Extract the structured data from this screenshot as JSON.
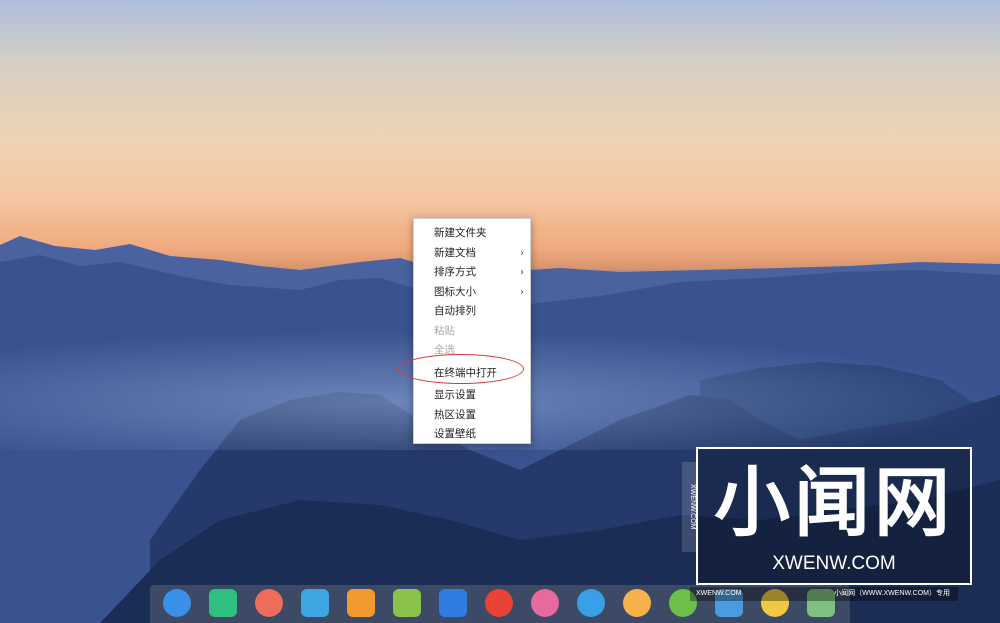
{
  "context_menu": {
    "items": [
      {
        "label": "新建文件夹",
        "submenu": false,
        "disabled": false
      },
      {
        "label": "新建文档",
        "submenu": true,
        "disabled": false
      },
      {
        "label": "排序方式",
        "submenu": true,
        "disabled": false
      },
      {
        "label": "图标大小",
        "submenu": true,
        "disabled": false
      },
      {
        "label": "自动排列",
        "submenu": false,
        "disabled": false
      },
      {
        "label": "粘贴",
        "submenu": false,
        "disabled": true
      },
      {
        "label": "全选",
        "submenu": false,
        "disabled": true
      },
      {
        "label": "在终端中打开",
        "submenu": false,
        "disabled": false,
        "highlighted": true
      },
      {
        "label": "显示设置",
        "submenu": false,
        "disabled": false
      },
      {
        "label": "热区设置",
        "submenu": false,
        "disabled": false
      },
      {
        "label": "设置壁纸",
        "submenu": false,
        "disabled": false
      }
    ],
    "submenu_glyph": "›",
    "highlight_color": "#d23b3b"
  },
  "dock": {
    "icons": [
      {
        "name": "launcher-icon",
        "color": "#3a8fe8"
      },
      {
        "name": "file-manager-icon",
        "color": "#2fbf7e"
      },
      {
        "name": "screen-recorder-icon",
        "color": "#ef6b5a"
      },
      {
        "name": "archive-manager-icon",
        "color": "#3da5e0"
      },
      {
        "name": "app-store-icon",
        "color": "#f29a2e"
      },
      {
        "name": "music-icon",
        "color": "#8bc34a"
      },
      {
        "name": "movie-icon",
        "color": "#2f7de1"
      },
      {
        "name": "chrome-icon",
        "color": "#ea4335"
      },
      {
        "name": "settings-icon",
        "color": "#e66aa0"
      },
      {
        "name": "clock-icon",
        "color": "#39a0e8"
      },
      {
        "name": "photo-icon",
        "color": "#f5b24a"
      },
      {
        "name": "terminal-icon",
        "color": "#6cc04a"
      },
      {
        "name": "mail-icon",
        "color": "#4a9be0"
      },
      {
        "name": "calendar-icon",
        "color": "#f0c842"
      },
      {
        "name": "trash-icon",
        "color": "#7fbf7f"
      }
    ]
  },
  "watermark": {
    "title": "小闻网",
    "subtitle": "XWENW.COM",
    "vertical_text": "XWENW.COM",
    "footer_left": "XWENW.COM",
    "footer_right": "小闻网（WWW.XWENW.COM）专用"
  }
}
